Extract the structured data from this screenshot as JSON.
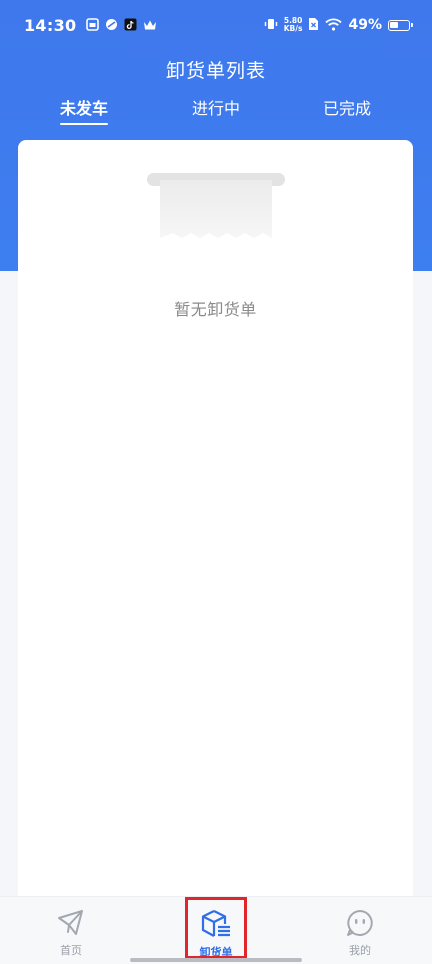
{
  "status_bar": {
    "time": "14:30",
    "net_speed_value": "5.80",
    "net_speed_unit": "KB/s",
    "battery_percent": "49%",
    "battery_level": 0.49,
    "icons": [
      "gallery-icon",
      "app-icon",
      "tiktok-icon",
      "crown-icon",
      "vibrate-icon",
      "no-sim-icon",
      "wifi-icon",
      "battery-icon"
    ]
  },
  "header": {
    "title": "卸货单列表"
  },
  "tabs": [
    {
      "label": "未发车",
      "active": true
    },
    {
      "label": "进行中",
      "active": false
    },
    {
      "label": "已完成",
      "active": false
    }
  ],
  "empty_state": {
    "message": "暂无卸货单",
    "icon": "empty-receipt-icon"
  },
  "tab_bar": {
    "items": [
      {
        "label": "首页",
        "icon": "paper-plane-icon",
        "active": false
      },
      {
        "label": "卸货单",
        "icon": "cube-list-icon",
        "active": true
      },
      {
        "label": "我的",
        "icon": "smiley-face-icon",
        "active": false
      }
    ]
  },
  "colors": {
    "primary": "#3d7ef0",
    "highlight": "#e0252b",
    "inactive": "#9aa0a8"
  }
}
